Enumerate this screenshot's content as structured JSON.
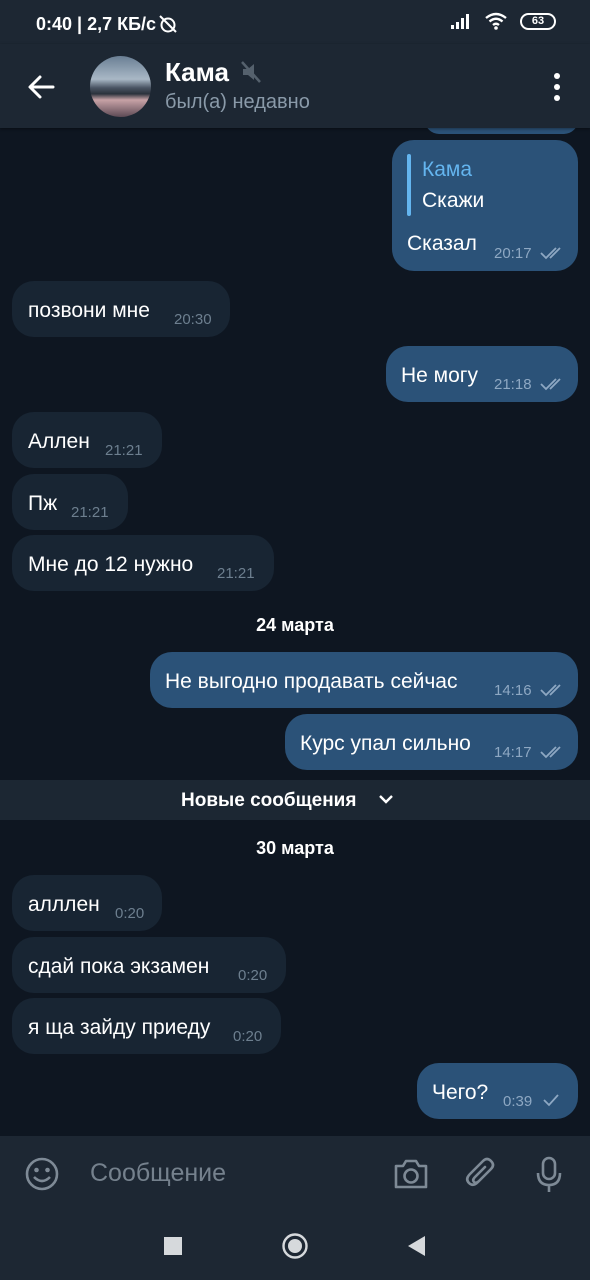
{
  "status": {
    "time_speed": "0:40 | 2,7 КБ/с",
    "battery": "63"
  },
  "header": {
    "name": "Кама",
    "status": "был(а) недавно"
  },
  "messages": {
    "m1": {
      "reply_author": "Кама",
      "reply_text": "Скажи",
      "text": "Сказал",
      "time": "20:17"
    },
    "m2": {
      "text": "позвони мне",
      "time": "20:30"
    },
    "m3": {
      "text": "Не могу",
      "time": "21:18"
    },
    "m4": {
      "text": "Аллен",
      "time": "21:21"
    },
    "m5": {
      "text": "Пж",
      "time": "21:21"
    },
    "m6": {
      "text": "Мне до 12 нужно",
      "time": "21:21"
    },
    "date1": "24 марта",
    "m7": {
      "text": "Не выгодно продавать сейчас",
      "time": "14:16"
    },
    "m8": {
      "text": "Курс упал сильно",
      "time": "14:17"
    },
    "new_banner": "Новые сообщения",
    "date2": "30 марта",
    "m9": {
      "text": "алллен",
      "time": "0:20"
    },
    "m10": {
      "text": "сдай пока экзамен",
      "time": "0:20"
    },
    "m11": {
      "text": "я ща зайду приеду",
      "time": "0:20"
    },
    "m12": {
      "text": "Чего?",
      "time": "0:39"
    }
  },
  "input": {
    "placeholder": "Сообщение"
  },
  "colors": {
    "accent": "#64b5ef",
    "outgoing": "#2b5278",
    "incoming": "#182533",
    "background": "#0e1621"
  }
}
